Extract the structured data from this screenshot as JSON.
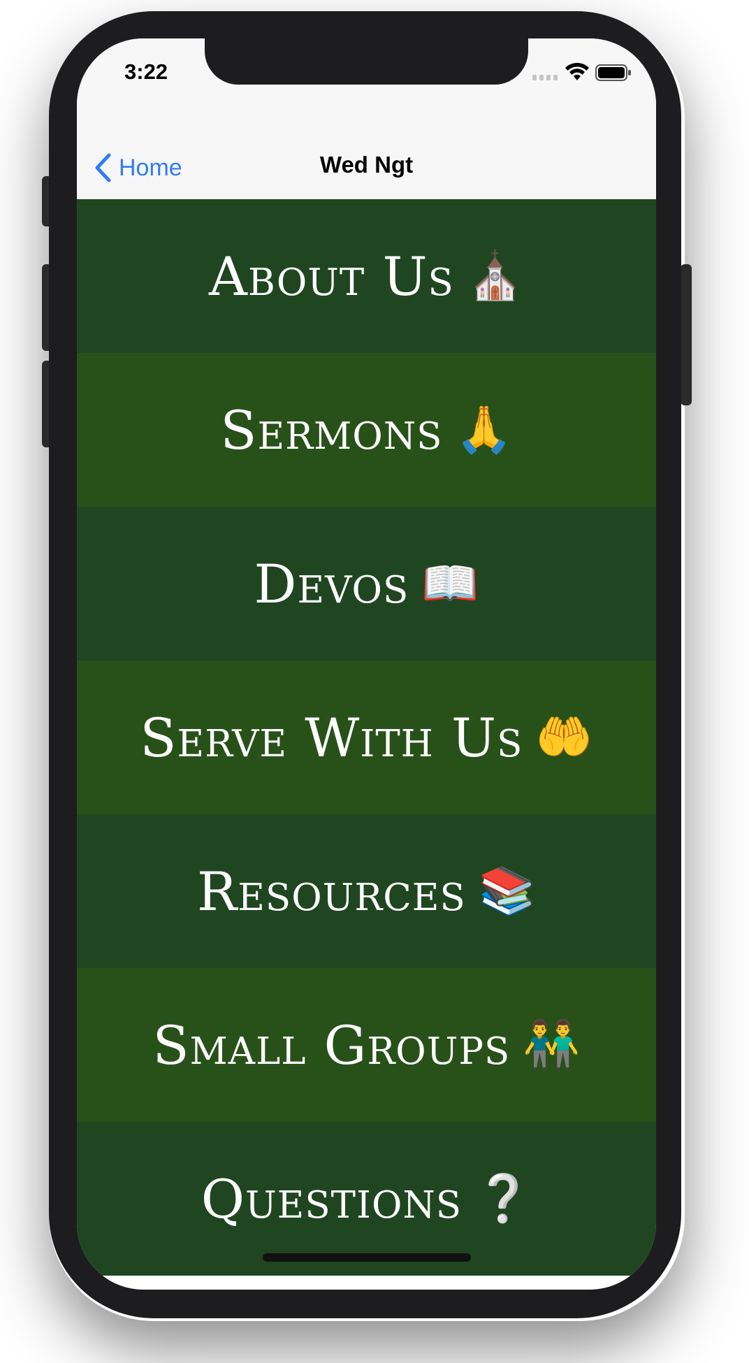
{
  "status_bar": {
    "time": "3:22"
  },
  "nav_bar": {
    "back_label": "Home",
    "title": "Wed Ngt",
    "accent_color": "#2f7cf6"
  },
  "menu": {
    "items": [
      {
        "label": "About Us",
        "icon": "⛪",
        "icon_name": "church-icon"
      },
      {
        "label": "Sermons",
        "icon": "🙏",
        "icon_name": "praying-hands-icon"
      },
      {
        "label": "Devos",
        "icon": "📖",
        "icon_name": "open-book-icon"
      },
      {
        "label": "Serve With Us",
        "icon": "🤲",
        "icon_name": "raised-hands-icon"
      },
      {
        "label": "Resources",
        "icon": "📚",
        "icon_name": "books-icon"
      },
      {
        "label": "Small Groups",
        "icon": "👬",
        "icon_name": "two-people-icon"
      },
      {
        "label": "Questions",
        "icon": "❔",
        "icon_name": "question-mark-icon"
      }
    ],
    "colors": {
      "dark_row": "#1f4620",
      "light_row": "#285119",
      "text": "#ffffff"
    }
  }
}
